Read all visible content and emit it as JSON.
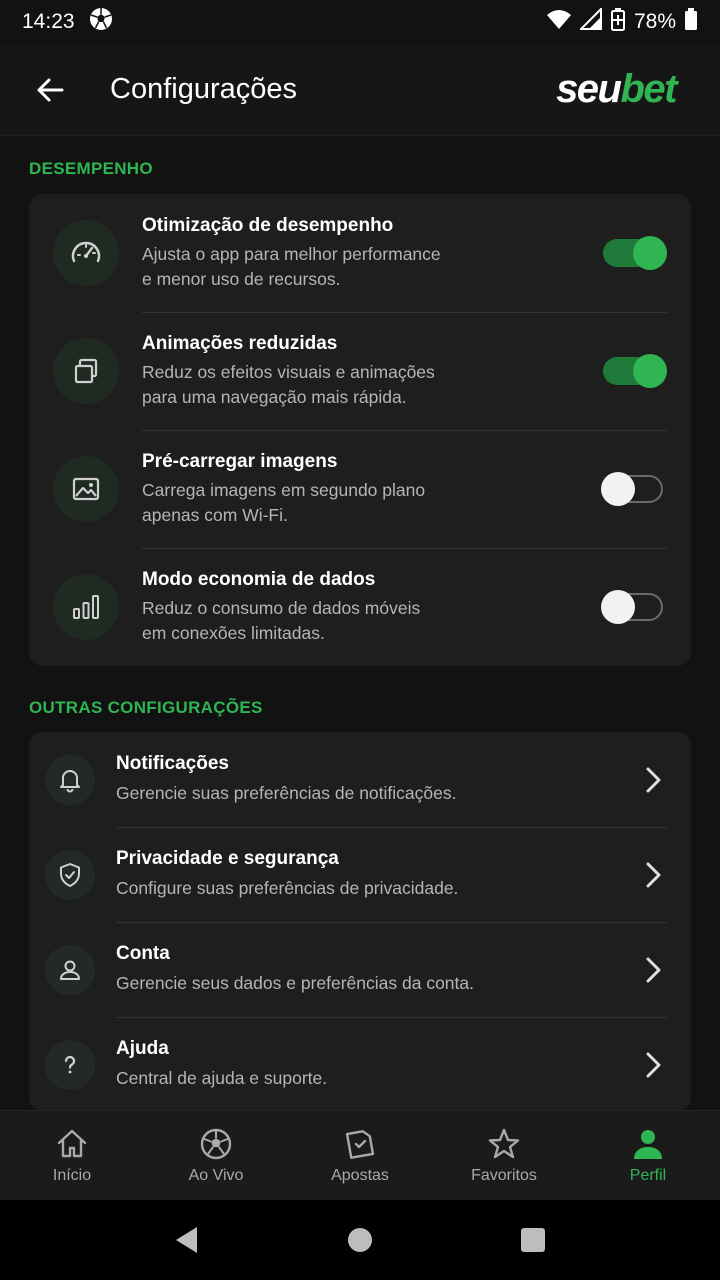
{
  "status_bar": {
    "time": "14:23",
    "battery": "78%"
  },
  "app_bar": {
    "title": "Configurações",
    "logo_part1": "seu",
    "logo_part2": "bet"
  },
  "sections": {
    "performance_title": "DESEMPENHO",
    "other_title": "OUTRAS CONFIGURAÇÕES"
  },
  "performance": [
    {
      "title": "Otimização de desempenho",
      "desc1": "Ajusta o app para melhor performance",
      "desc2": "e menor uso de recursos.",
      "enabled": true,
      "icon": "speedometer-icon"
    },
    {
      "title": "Animações reduzidas",
      "desc1": "Reduz os efeitos visuais e animações",
      "desc2": "para uma navegação mais rápida.",
      "enabled": true,
      "icon": "layers-icon"
    },
    {
      "title": "Pré-carregar imagens",
      "desc1": "Carrega imagens em segundo plano",
      "desc2": "apenas com Wi-Fi.",
      "enabled": false,
      "icon": "image-icon"
    },
    {
      "title": "Modo economia de dados",
      "desc1": "Reduz o consumo de dados móveis",
      "desc2": "em conexões limitadas.",
      "enabled": false,
      "icon": "data-bars-icon"
    }
  ],
  "other": [
    {
      "title": "Notificações",
      "desc": "Gerencie suas preferências de notificações.",
      "icon": "bell-icon"
    },
    {
      "title": "Privacidade e segurança",
      "desc": "Configure suas preferências de privacidade.",
      "icon": "shield-check-icon"
    },
    {
      "title": "Conta",
      "desc": "Gerencie seus dados e preferências da conta.",
      "icon": "user-icon"
    },
    {
      "title": "Ajuda",
      "desc": "Central de ajuda e suporte.",
      "icon": "help-icon"
    }
  ],
  "bottom_nav": [
    {
      "label": "Início",
      "icon": "home-icon",
      "active": false
    },
    {
      "label": "Ao Vivo",
      "icon": "soccer-ball-icon",
      "active": false
    },
    {
      "label": "Apostas",
      "icon": "ticket-icon",
      "active": false
    },
    {
      "label": "Favoritos",
      "icon": "star-icon",
      "active": false
    },
    {
      "label": "Perfil",
      "icon": "profile-icon",
      "active": true
    }
  ],
  "colors": {
    "accent": "#2fb552",
    "background": "#121212",
    "card": "#1e1e1e"
  }
}
